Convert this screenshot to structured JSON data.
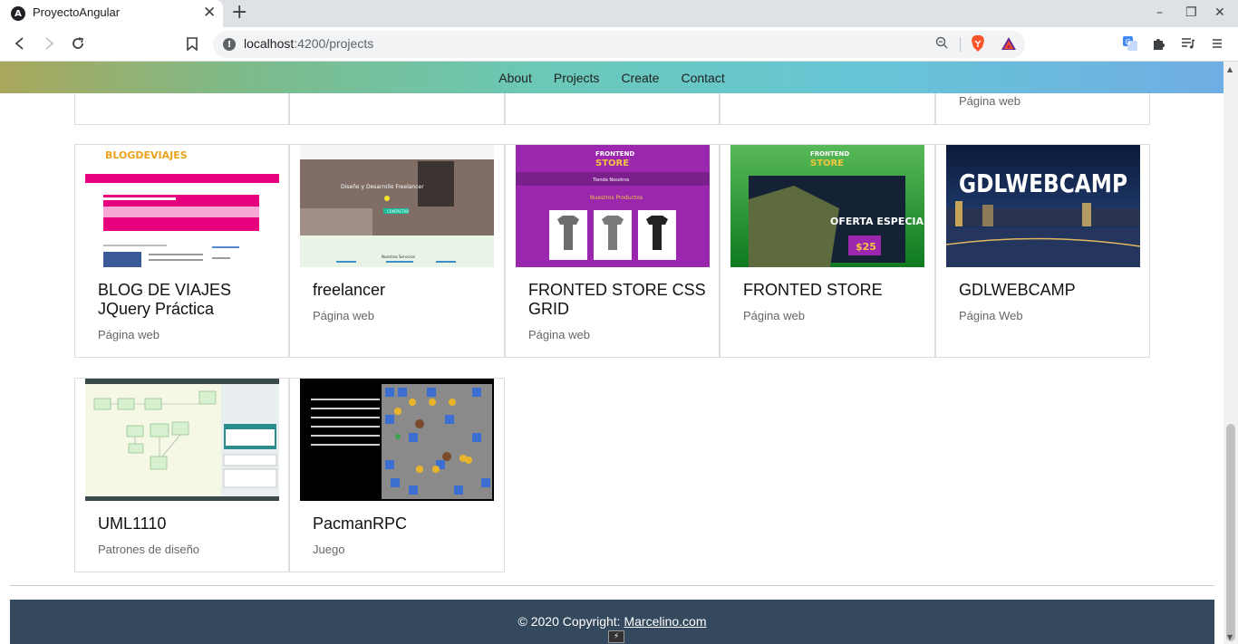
{
  "browser": {
    "tab_title": "ProyectoAngular",
    "favicon_letter": "A",
    "tab_close": "✕",
    "new_tab": "+",
    "url_host": "localhost",
    "url_path": ":4200/projects",
    "window_buttons": {
      "minimize": "–",
      "restore": "❐",
      "close": "✕"
    }
  },
  "nav": {
    "links": [
      "About",
      "Projects",
      "Create",
      "Contact"
    ]
  },
  "top_row_partial": {
    "last_subtitle": "Página web"
  },
  "projects": [
    {
      "title": "BLOG DE VIAJES JQuery Práctica",
      "subtitle": "Página web",
      "thumb": "blog"
    },
    {
      "title": "freelancer",
      "subtitle": "Página web",
      "thumb": "freelancer"
    },
    {
      "title": "FRONTED STORE CSS GRID",
      "subtitle": "Página web",
      "thumb": "store-grid"
    },
    {
      "title": "FRONTED STORE",
      "subtitle": "Página web",
      "thumb": "store"
    },
    {
      "title": "GDLWEBCAMP",
      "subtitle": "Página Web",
      "thumb": "gdl"
    },
    {
      "title": "UML1110",
      "subtitle": "Patrones de diseño",
      "thumb": "uml"
    },
    {
      "title": "PacmanRPC",
      "subtitle": "Juego",
      "thumb": "pacman"
    }
  ],
  "thumbs_text": {
    "blog_logo": "BLOGDEVIAJES",
    "freelancer_heading": "Diseño y Desarrollo Freelancer",
    "freelancer_button": "CONTACTAR",
    "freelancer_services": "Nuestros Servicios",
    "store_logo_top": "FRONTEND",
    "store_logo_bottom": "STORE",
    "store_nav": "Tienda   Nosotros",
    "store_products": "Nuestros Productos",
    "store_offer": "OFERTA ESPECIAL",
    "store_price": "$25",
    "gdl_logo": "GDLWEBCAMP"
  },
  "footer": {
    "copyright": "© 2020 Copyright: ",
    "link": "Marcelino.com",
    "badge": "⚡"
  }
}
